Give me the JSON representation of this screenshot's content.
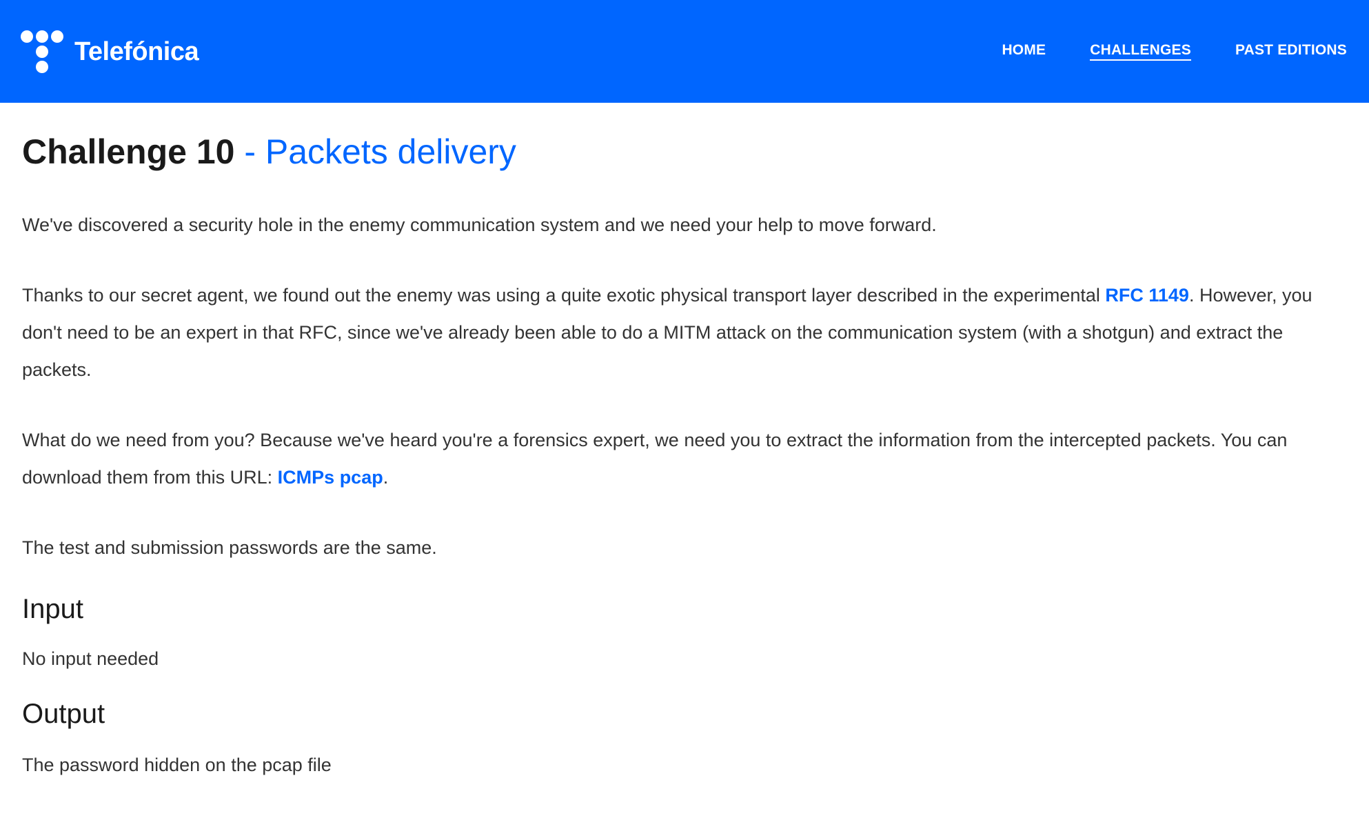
{
  "header": {
    "logo_text": "Telefónica",
    "nav": [
      {
        "label": "HOME"
      },
      {
        "label": "CHALLENGES"
      },
      {
        "label": "PAST EDITIONS"
      }
    ]
  },
  "page": {
    "title_main": "Challenge 10",
    "title_sep": " - ",
    "title_sub": "Packets delivery",
    "para1": "We've discovered a security hole in the enemy communication system and we need your help to move forward.",
    "para2_part1": "Thanks to our secret agent, we found out the enemy was using a quite exotic physical transport layer described in the experimental ",
    "para2_link": "RFC 1149",
    "para2_part2": ". However, you don't need to be an expert in that RFC, since we've already been able to do a MITM attack on the communication system (with a shotgun) and extract the packets.",
    "para3_part1": "What do we need from you? Because we've heard you're a forensics expert, we need you to extract the information from the intercepted packets. You can download them from this URL: ",
    "para3_link": "ICMPs pcap",
    "para3_part2": ".",
    "para4": "The test and submission passwords are the same.",
    "input_heading": "Input",
    "input_text": "No input needed",
    "output_heading": "Output",
    "output_text": "The password hidden on the pcap file"
  },
  "colors": {
    "brand_blue": "#0066ff",
    "text": "#333333",
    "heading": "#1a1a1a"
  }
}
